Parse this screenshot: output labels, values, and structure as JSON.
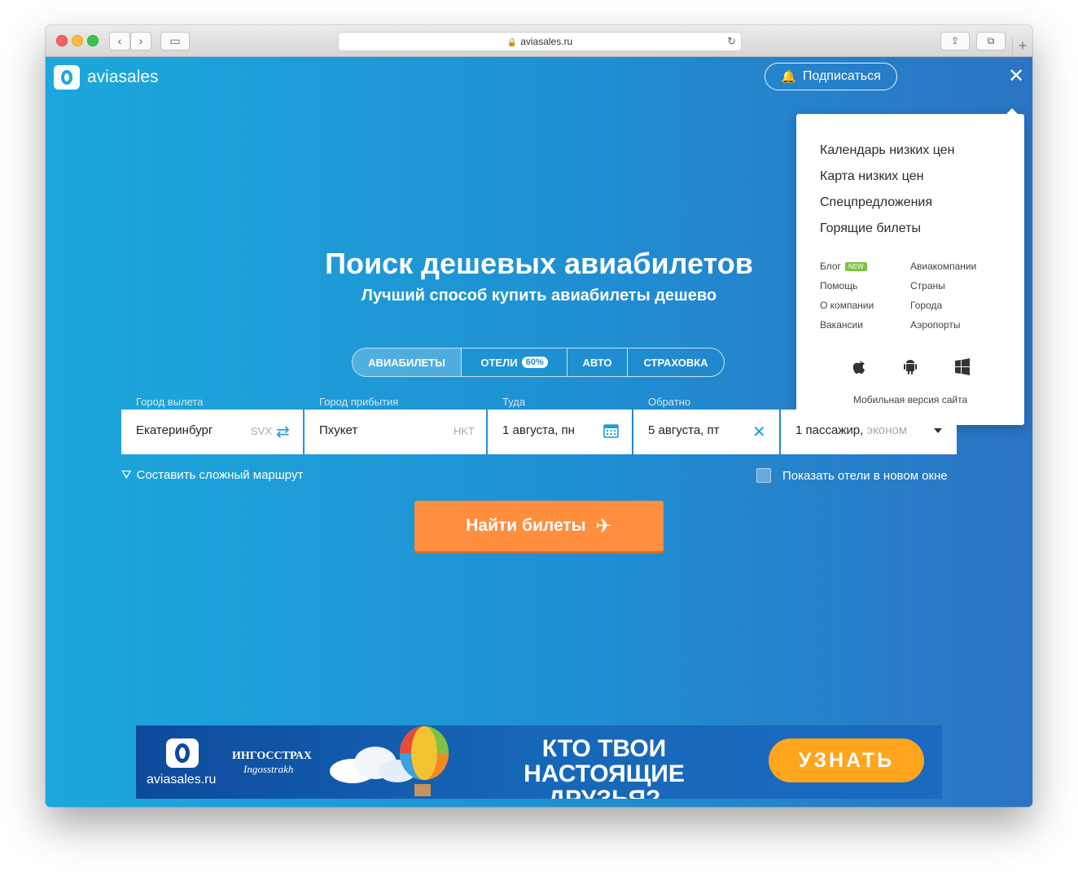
{
  "browser": {
    "url": "aviasales.ru"
  },
  "header": {
    "logo_text": "aviasales",
    "subscribe_label": "Подписаться"
  },
  "menu": {
    "main_items": [
      "Календарь низких цен",
      "Карта низких цен",
      "Спецпредложения",
      "Горящие билеты"
    ],
    "left_links": [
      "Блог",
      "Помощь",
      "О компании",
      "Вакансии"
    ],
    "right_links": [
      "Авиакомпании",
      "Страны",
      "Города",
      "Аэропорты"
    ],
    "new_badge": "NEW",
    "os_icons": [
      "apple-icon",
      "android-icon",
      "windows-icon"
    ],
    "mobile_label": "Мобильная версия сайта"
  },
  "hero": {
    "title": "Поиск дешевых авиабилетов",
    "subtitle": "Лучший способ купить авиабилеты дешево"
  },
  "tabs": [
    {
      "label": "АВИАБИЛЕТЫ",
      "active": true
    },
    {
      "label": "ОТЕЛИ",
      "badge": "60%"
    },
    {
      "label": "АВТО"
    },
    {
      "label": "СТРАХОВКА"
    }
  ],
  "form": {
    "origin_label": "Город вылета",
    "origin_value": "Екатеринбург",
    "origin_code": "SVX",
    "destination_label": "Город прибытия",
    "destination_value": "Пхукет",
    "destination_code": "HKT",
    "depart_label": "Туда",
    "depart_value": "1 августа, пн",
    "return_label": "Обратно",
    "return_value": "5 августа, пт",
    "passengers_value": "1 пассажир,",
    "class_value": "эконом"
  },
  "options": {
    "complex_route": "Составить сложный маршрут",
    "hotels_new_window": "Показать отели в новом окне"
  },
  "search_button": "Найти билеты",
  "banner": {
    "site": "aviasales.ru",
    "partner": "ИНГОССТРАХ",
    "partner_script": "Ingosstrakh",
    "line1": "КТО ТВОИ",
    "line2": "НАСТОЯЩИЕ ДРУЗЬЯ?",
    "cta": "УЗНАТЬ"
  },
  "colors": {
    "gradient_start": "#1ca8dc",
    "gradient_end": "#2b74c4",
    "search_button": "#ff8e3f",
    "banner_cta": "#ffa51e",
    "new_badge": "#7dc241"
  }
}
